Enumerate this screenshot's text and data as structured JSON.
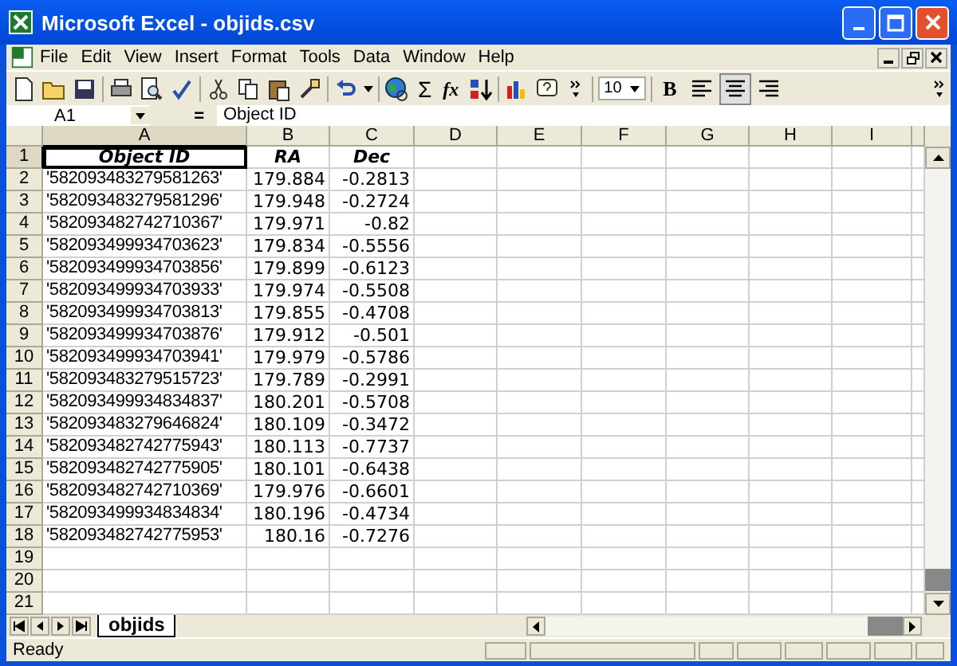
{
  "window": {
    "title": "Microsoft Excel - objids.csv"
  },
  "menu": [
    "File",
    "Edit",
    "View",
    "Insert",
    "Format",
    "Tools",
    "Data",
    "Window",
    "Help"
  ],
  "toolbar": {
    "sum_label": "Σ",
    "function_label": "fx",
    "font_size": "10",
    "bold": {
      "label": "B",
      "pressed": false
    },
    "align_buttons": [
      {
        "selected": false
      },
      {
        "selected": true
      },
      {
        "selected": false
      }
    ]
  },
  "formula_bar": {
    "name_box": "A1",
    "equals": "=",
    "content": "Object ID"
  },
  "columns": [
    {
      "letter": "A",
      "selected": true
    },
    {
      "letter": "B",
      "selected": false
    },
    {
      "letter": "C",
      "selected": false
    },
    {
      "letter": "D",
      "selected": false
    },
    {
      "letter": "E",
      "selected": false
    },
    {
      "letter": "F",
      "selected": false
    },
    {
      "letter": "G",
      "selected": false
    },
    {
      "letter": "H",
      "selected": false
    },
    {
      "letter": "I",
      "selected": false
    }
  ],
  "rows": [
    {
      "number": "1",
      "selected": true,
      "kind": "header",
      "cells": [
        "Object ID",
        "RA",
        "Dec"
      ]
    },
    {
      "number": "2",
      "selected": false,
      "kind": "data",
      "cells": [
        "'582093483279581263'",
        "179.884",
        "-0.2813"
      ]
    },
    {
      "number": "3",
      "selected": false,
      "kind": "data",
      "cells": [
        "'582093483279581296'",
        "179.948",
        "-0.2724"
      ]
    },
    {
      "number": "4",
      "selected": false,
      "kind": "data",
      "cells": [
        "'582093482742710367'",
        "179.971",
        "-0.82"
      ]
    },
    {
      "number": "5",
      "selected": false,
      "kind": "data",
      "cells": [
        "'582093499934703623'",
        "179.834",
        "-0.5556"
      ]
    },
    {
      "number": "6",
      "selected": false,
      "kind": "data",
      "cells": [
        "'582093499934703856'",
        "179.899",
        "-0.6123"
      ]
    },
    {
      "number": "7",
      "selected": false,
      "kind": "data",
      "cells": [
        "'582093499934703933'",
        "179.974",
        "-0.5508"
      ]
    },
    {
      "number": "8",
      "selected": false,
      "kind": "data",
      "cells": [
        "'582093499934703813'",
        "179.855",
        "-0.4708"
      ]
    },
    {
      "number": "9",
      "selected": false,
      "kind": "data",
      "cells": [
        "'582093499934703876'",
        "179.912",
        "-0.501"
      ]
    },
    {
      "number": "10",
      "selected": false,
      "kind": "data",
      "cells": [
        "'582093499934703941'",
        "179.979",
        "-0.5786"
      ]
    },
    {
      "number": "11",
      "selected": false,
      "kind": "data",
      "cells": [
        "'582093483279515723'",
        "179.789",
        "-0.2991"
      ]
    },
    {
      "number": "12",
      "selected": false,
      "kind": "data",
      "cells": [
        "'582093499934834837'",
        "180.201",
        "-0.5708"
      ]
    },
    {
      "number": "13",
      "selected": false,
      "kind": "data",
      "cells": [
        "'582093483279646824'",
        "180.109",
        "-0.3472"
      ]
    },
    {
      "number": "14",
      "selected": false,
      "kind": "data",
      "cells": [
        "'582093482742775943'",
        "180.113",
        "-0.7737"
      ]
    },
    {
      "number": "15",
      "selected": false,
      "kind": "data",
      "cells": [
        "'582093482742775905'",
        "180.101",
        "-0.6438"
      ]
    },
    {
      "number": "16",
      "selected": false,
      "kind": "data",
      "cells": [
        "'582093482742710369'",
        "179.976",
        "-0.6601"
      ]
    },
    {
      "number": "17",
      "selected": false,
      "kind": "data",
      "cells": [
        "'582093499934834834'",
        "180.196",
        "-0.4734"
      ]
    },
    {
      "number": "18",
      "selected": false,
      "kind": "data",
      "cells": [
        "'582093482742775953'",
        "180.16",
        "-0.7276"
      ]
    },
    {
      "number": "19",
      "selected": false,
      "kind": "data"
    },
    {
      "number": "20",
      "selected": false,
      "kind": "data"
    },
    {
      "number": "21",
      "selected": false,
      "kind": "data"
    }
  ],
  "sheet_tabs": [
    {
      "label": "objids",
      "selected": true
    }
  ],
  "status_bar": {
    "text": "Ready"
  }
}
